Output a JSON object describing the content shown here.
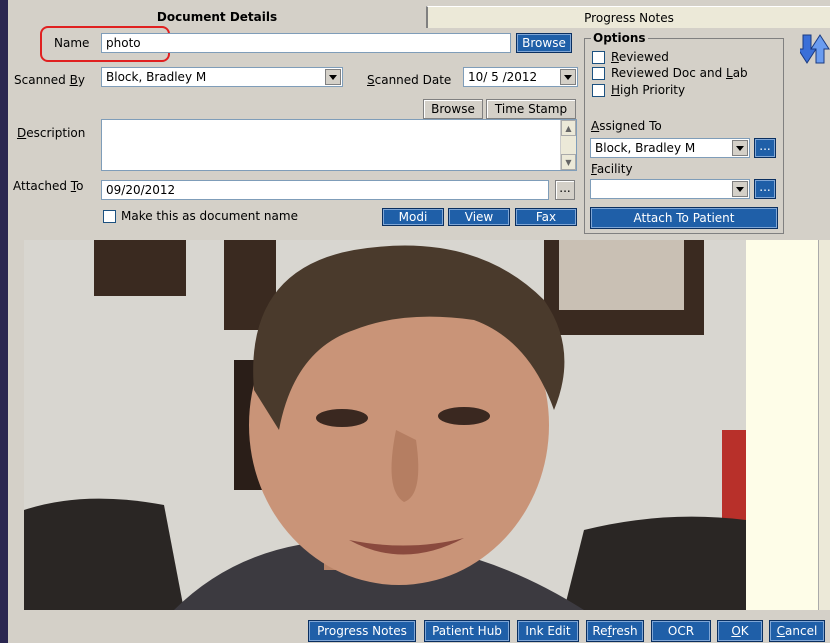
{
  "tabs": {
    "active": "Document Details",
    "inactive": "Progress Notes"
  },
  "form": {
    "name_label": "Name",
    "name_value": "photo",
    "browse_label": "Browse",
    "scanned_by_label_pre": "Scanned ",
    "scanned_by_label_u": "B",
    "scanned_by_label_post": "y",
    "scanned_by_value": "Block, Bradley M",
    "scanned_date_label_u": "S",
    "scanned_date_label_post": "canned Date",
    "scanned_date_value": "10/ 5 /2012",
    "browse2_label": "Browse",
    "timestamp_label": "Time Stamp",
    "description_label_u": "D",
    "description_label_post": "escription",
    "description_value": "",
    "attached_to_label_pre": "Attached ",
    "attached_to_label_u": "T",
    "attached_to_label_post": "o",
    "attached_to_value": "09/20/2012",
    "attached_btn": "...",
    "make_doc_name_label": "Make this as document name",
    "modi_label": "Modi",
    "view_label": "View",
    "fax_label": "Fax"
  },
  "options": {
    "title": "Options",
    "reviewed_u": "R",
    "reviewed_post": "eviewed",
    "reviewed_doc_pre": "Reviewed Doc and ",
    "reviewed_doc_u": "L",
    "reviewed_doc_post": "ab",
    "high_priority_u": "H",
    "high_priority_post": "igh Priority",
    "assigned_to_u": "A",
    "assigned_to_post": "ssigned To",
    "assigned_to_value": "Block, Bradley M",
    "assigned_btn": "...",
    "facility_u": "F",
    "facility_post": "acility",
    "facility_value": "",
    "facility_btn": "...",
    "attach_label": "Attach To Patient"
  },
  "bottom": {
    "progress_notes": "Progress Notes",
    "patient_hub": "Patient Hub",
    "ink_edit": "Ink Edit",
    "refresh_pre": "Re",
    "refresh_u": "f",
    "refresh_post": "resh",
    "ocr": "OCR",
    "ok_u": "O",
    "ok_post": "K",
    "cancel_u": "C",
    "cancel_post": "ancel"
  },
  "colors": {
    "accent": "#1f5fa8",
    "highlight": "#e02020",
    "panel": "#d4d0c8"
  }
}
